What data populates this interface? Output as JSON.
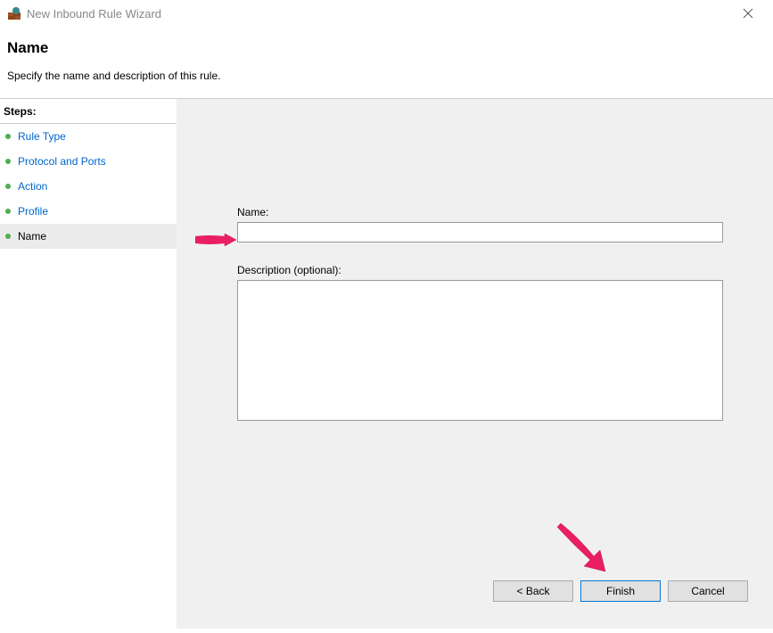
{
  "titlebar": {
    "title": "New Inbound Rule Wizard"
  },
  "header": {
    "title": "Name",
    "subtitle": "Specify the name and description of this rule."
  },
  "sidebar": {
    "steps_label": "Steps:",
    "items": [
      {
        "label": "Rule Type"
      },
      {
        "label": "Protocol and Ports"
      },
      {
        "label": "Action"
      },
      {
        "label": "Profile"
      },
      {
        "label": "Name"
      }
    ]
  },
  "form": {
    "name_label": "Name:",
    "name_value": "",
    "desc_label": "Description (optional):",
    "desc_value": ""
  },
  "buttons": {
    "back": "< Back",
    "finish": "Finish",
    "cancel": "Cancel"
  }
}
